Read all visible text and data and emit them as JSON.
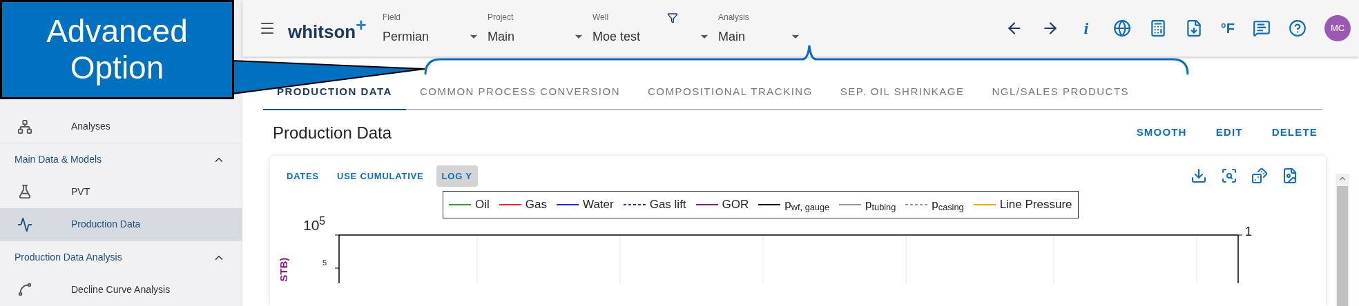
{
  "callout": {
    "text": "Advanced Option"
  },
  "sidebar": {
    "items": [
      {
        "kind": "link",
        "label": "Analyses",
        "selected": false
      },
      {
        "kind": "section",
        "label": "Main Data & Models",
        "expanded": true
      },
      {
        "kind": "link",
        "label": "PVT",
        "selected": false
      },
      {
        "kind": "link",
        "label": "Production Data",
        "selected": true
      },
      {
        "kind": "section",
        "label": "Production Data Analysis",
        "expanded": true
      },
      {
        "kind": "link",
        "label": "Decline Curve Analysis",
        "selected": false
      }
    ]
  },
  "top_bar": {
    "logo": {
      "name": "whitson",
      "mark": "+"
    },
    "selectors": [
      {
        "label": "Field",
        "value": "Permian",
        "filter": false
      },
      {
        "label": "Project",
        "value": "Main",
        "filter": false
      },
      {
        "label": "Well",
        "value": "Moe test",
        "filter": true
      },
      {
        "label": "Analysis",
        "value": "Main",
        "filter": false
      }
    ],
    "info_button": "i",
    "unit_button": "°F",
    "avatar": "MC"
  },
  "tabs": [
    {
      "label": "PRODUCTION DATA",
      "selected": true
    },
    {
      "label": "COMMON PROCESS CONVERSION",
      "selected": false
    },
    {
      "label": "COMPOSITIONAL TRACKING",
      "selected": false
    },
    {
      "label": "SEP. OIL SHRINKAGE",
      "selected": false
    },
    {
      "label": "NGL/SALES PRODUCTS",
      "selected": false
    }
  ],
  "page": {
    "title": "Production Data",
    "actions": [
      "SMOOTH",
      "EDIT",
      "DELETE"
    ]
  },
  "chart_card": {
    "toggles": [
      {
        "label": "DATES",
        "selected": false
      },
      {
        "label": "USE CUMULATIVE",
        "selected": false
      },
      {
        "label": "LOG Y",
        "selected": true
      }
    ],
    "legend": [
      {
        "label": "Oil",
        "color": "#2ca02c",
        "kind": "solid"
      },
      {
        "label": "Gas",
        "color": "#ff2020",
        "kind": "solid"
      },
      {
        "label": "Water",
        "color": "#1f1fff",
        "kind": "solid"
      },
      {
        "label": "Gas lift",
        "color": "#1f3f7f",
        "kind": "dashed"
      },
      {
        "label": "GOR",
        "color": "#8b1a8b",
        "kind": "solid"
      },
      {
        "label": "p$_{wf, gauge}$",
        "color": "#000000",
        "kind": "solid"
      },
      {
        "label": "p$_{tubing}$",
        "color": "#9a9a9a",
        "kind": "solid"
      },
      {
        "label": "p$_{casing}$",
        "color": "#9a9a9a",
        "kind": "dashed"
      },
      {
        "label": "Line Pressure",
        "color": "#ffa500",
        "kind": "solid"
      }
    ],
    "y_axis_label": "STB)",
    "left_ticks": [
      "10$^{5}$",
      "5"
    ],
    "right_tick": "1"
  }
}
